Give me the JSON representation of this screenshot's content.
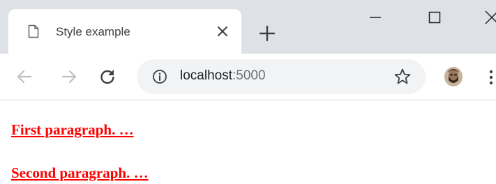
{
  "tab": {
    "title": "Style example",
    "icon": "document-icon"
  },
  "window_controls": [
    "minimize-icon",
    "maximize-icon",
    "close-icon"
  ],
  "toolbar": {
    "url_host": "localhost",
    "url_port": ":5000"
  },
  "content": {
    "paragraphs": [
      "First paragraph. …",
      "Second paragraph. …"
    ],
    "paragraph_color": "#ff0000"
  },
  "colors": {
    "tab_strip": "#dee1e6",
    "omnibox": "#f1f3f4"
  }
}
